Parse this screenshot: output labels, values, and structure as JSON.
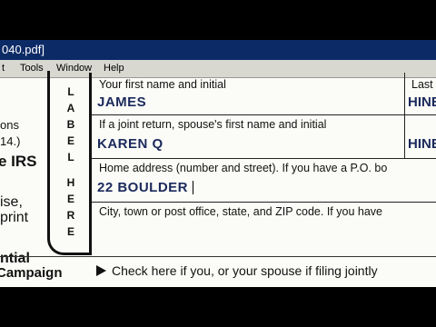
{
  "window": {
    "title": "040.pdf]"
  },
  "menu": [
    "t",
    "Tools",
    "Window",
    "Help"
  ],
  "left_margin": [
    "ons",
    "14.)",
    "e IRS",
    "ise,",
    "print",
    "ntial",
    "Campaign"
  ],
  "label_letters": [
    "L",
    "A",
    "B",
    "E",
    "L",
    "H",
    "E",
    "R",
    "E"
  ],
  "form": {
    "first_name_caption": "Your first name and initial",
    "first_name_value": "JAMES",
    "last_name_caption": "Last",
    "last_name_value": "HINE",
    "spouse_caption": "If a joint return, spouse's first name and initial",
    "spouse_value": "KAREN Q",
    "spouse_last_value": "HINE",
    "address_caption": "Home address (number and street). If you have a P.O. bo",
    "address_value": "22 BOULDER",
    "city_caption": "City, town or post office, state, and ZIP code. If you have"
  },
  "campaign": {
    "check_text": "Check here if you, or your spouse if filing jointly"
  }
}
